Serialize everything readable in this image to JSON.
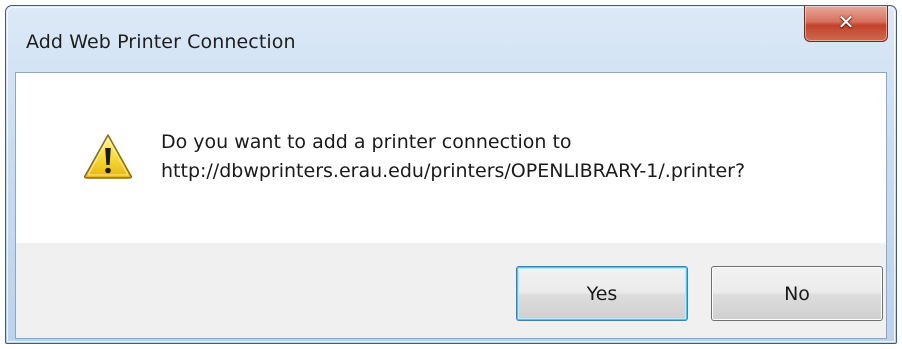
{
  "window": {
    "title": "Add Web Printer Connection",
    "close_icon": "close-icon"
  },
  "dialog": {
    "icon": "warning-icon",
    "message_line1": "Do you want to add a printer connection to",
    "message_line2": "http://dbwprinters.erau.edu/printers/OPENLIBRARY-1/.printer?"
  },
  "buttons": {
    "yes_label": "Yes",
    "no_label": "No"
  },
  "colors": {
    "titlebar": "#c9dcf0",
    "close_button": "#c1432b",
    "dialog_body": "#ffffff",
    "button_area": "#f0f0f0",
    "default_button_border": "#3c7fb1",
    "warning_yellow": "#f5d32c"
  }
}
